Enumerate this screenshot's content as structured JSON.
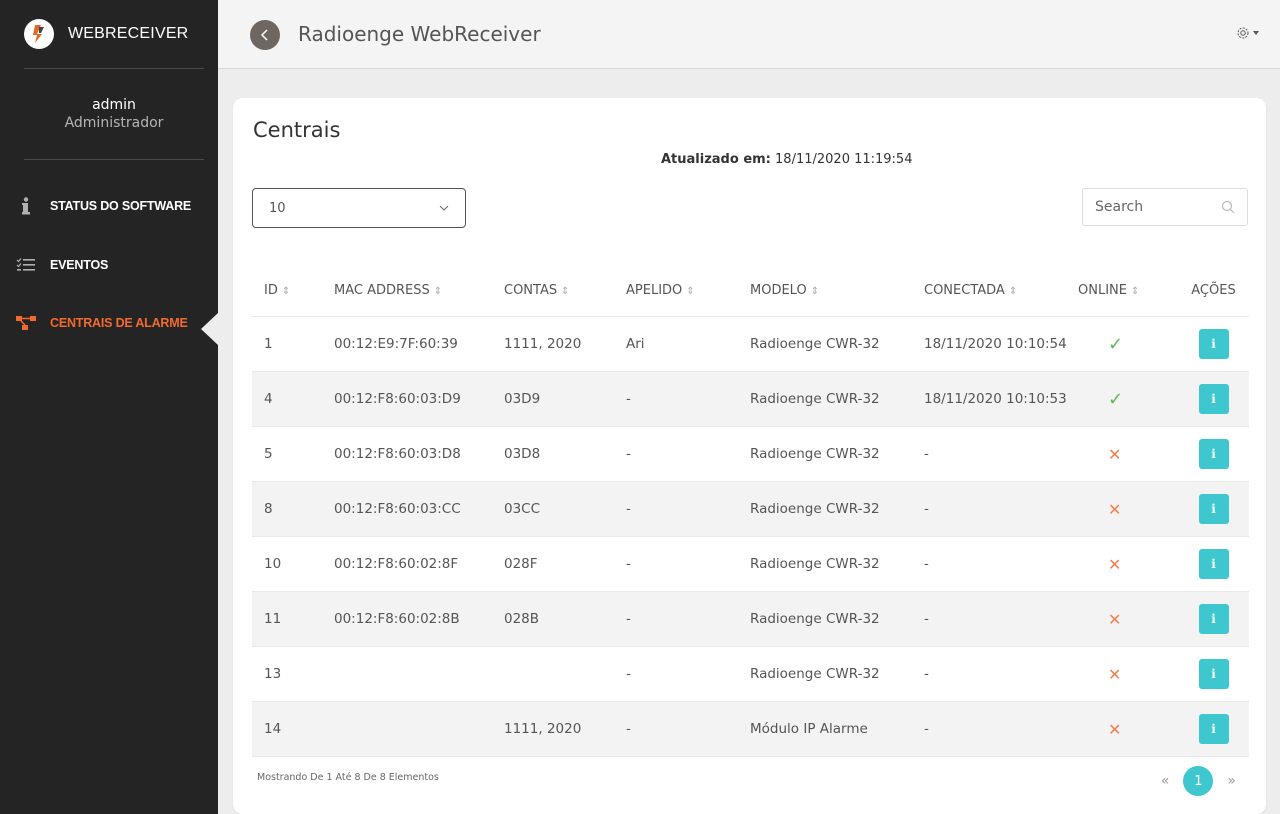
{
  "brand": {
    "name": "WEBRECEIVER"
  },
  "user": {
    "name": "admin",
    "role": "Administrador"
  },
  "nav": [
    {
      "label": "STATUS DO SOFTWARE",
      "icon": "info-icon"
    },
    {
      "label": "EVENTOS",
      "icon": "checklist-icon"
    },
    {
      "label": "CENTRAIS DE ALARME",
      "icon": "network-icon",
      "active": true
    }
  ],
  "header": {
    "title": "Radioenge WebReceiver"
  },
  "page": {
    "title": "Centrais",
    "updated_label": "Atualizado em:",
    "updated_value": "18/11/2020 11:19:54",
    "page_length": "10",
    "search_placeholder": "Search"
  },
  "table": {
    "columns": [
      "ID",
      "MAC ADDRESS",
      "CONTAS",
      "APELIDO",
      "MODELO",
      "CONECTADA",
      "ONLINE",
      "AÇÕES"
    ],
    "rows": [
      {
        "id": "1",
        "mac": "00:12:E9:7F:60:39",
        "contas": "1111, 2020",
        "apelido": "Ari",
        "modelo": "Radioenge CWR-32",
        "conectada": "18/11/2020 10:10:54",
        "online": true
      },
      {
        "id": "4",
        "mac": "00:12:F8:60:03:D9",
        "contas": "03D9",
        "apelido": "-",
        "modelo": "Radioenge CWR-32",
        "conectada": "18/11/2020 10:10:53",
        "online": true
      },
      {
        "id": "5",
        "mac": "00:12:F8:60:03:D8",
        "contas": "03D8",
        "apelido": "-",
        "modelo": "Radioenge CWR-32",
        "conectada": "-",
        "online": false
      },
      {
        "id": "8",
        "mac": "00:12:F8:60:03:CC",
        "contas": "03CC",
        "apelido": "-",
        "modelo": "Radioenge CWR-32",
        "conectada": "-",
        "online": false
      },
      {
        "id": "10",
        "mac": "00:12:F8:60:02:8F",
        "contas": "028F",
        "apelido": "-",
        "modelo": "Radioenge CWR-32",
        "conectada": "-",
        "online": false
      },
      {
        "id": "11",
        "mac": "00:12:F8:60:02:8B",
        "contas": "028B",
        "apelido": "-",
        "modelo": "Radioenge CWR-32",
        "conectada": "-",
        "online": false
      },
      {
        "id": "13",
        "mac": "",
        "contas": "",
        "apelido": "-",
        "modelo": "Radioenge CWR-32",
        "conectada": "-",
        "online": false
      },
      {
        "id": "14",
        "mac": "",
        "contas": "1111, 2020",
        "apelido": "-",
        "modelo": "Módulo IP Alarme",
        "conectada": "-",
        "online": false
      }
    ]
  },
  "footer": {
    "info": "Mostrando De 1 Até 8 De 8 Elementos",
    "prev": "«",
    "current_page": "1",
    "next": "»"
  },
  "colors": {
    "sidebar": "#242424",
    "accent": "#f26a2e",
    "teal": "#3ec7cf",
    "online": "#5cb85c",
    "offline": "#f0814a"
  }
}
